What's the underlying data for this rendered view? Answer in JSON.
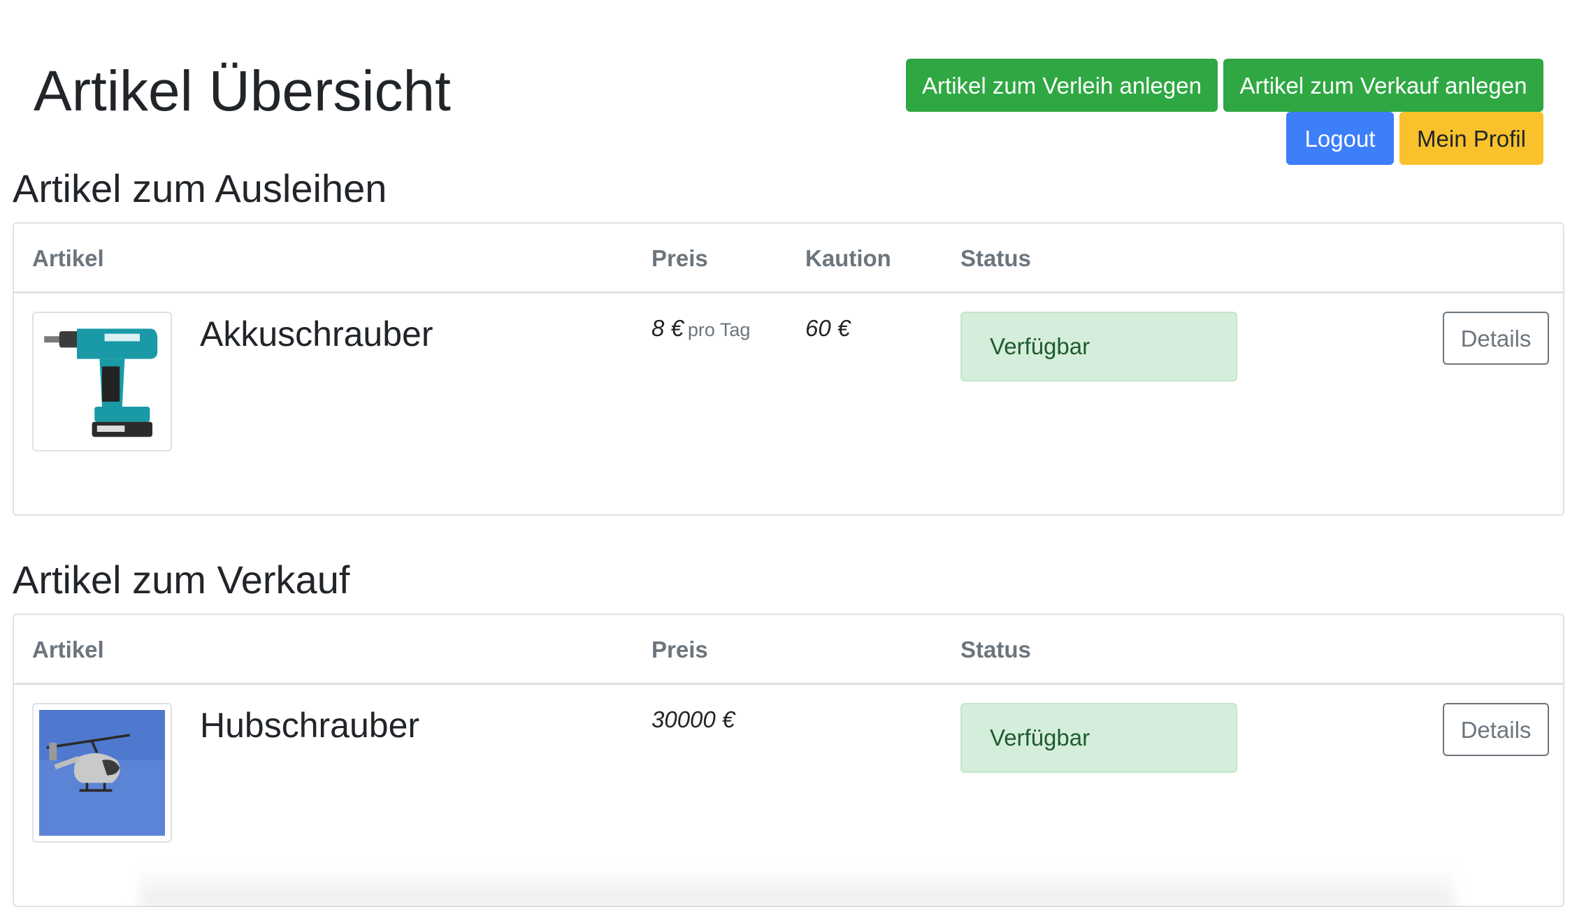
{
  "header": {
    "title": "Artikel Übersicht",
    "buttons": {
      "rent_create": "Artikel zum Verleih anlegen",
      "sale_create": "Artikel zum Verkauf anlegen",
      "logout": "Logout",
      "profile": "Mein Profil"
    }
  },
  "rent_section": {
    "title": "Artikel zum Ausleihen",
    "columns": {
      "item": "Artikel",
      "price": "Preis",
      "deposit": "Kaution",
      "status": "Status"
    },
    "rows": [
      {
        "name": "Akkuschrauber",
        "price": "8 €",
        "price_unit": "pro Tag",
        "deposit": "60 €",
        "status": "Verfügbar",
        "details": "Details",
        "image": "cordless-drill-image"
      }
    ]
  },
  "sale_section": {
    "title": "Artikel zum Verkauf",
    "columns": {
      "item": "Artikel",
      "price": "Preis",
      "status": "Status"
    },
    "rows": [
      {
        "name": "Hubschrauber",
        "price": "30000 €",
        "status": "Verfügbar",
        "details": "Details",
        "image": "helicopter-image"
      }
    ]
  },
  "colors": {
    "success": "#2fa843",
    "primary": "#3d7ef9",
    "warning": "#f9c22c",
    "status_bg": "#d5eedb",
    "status_text": "#1e5c2e",
    "border": "#dee2e6",
    "muted": "#6c757d"
  }
}
